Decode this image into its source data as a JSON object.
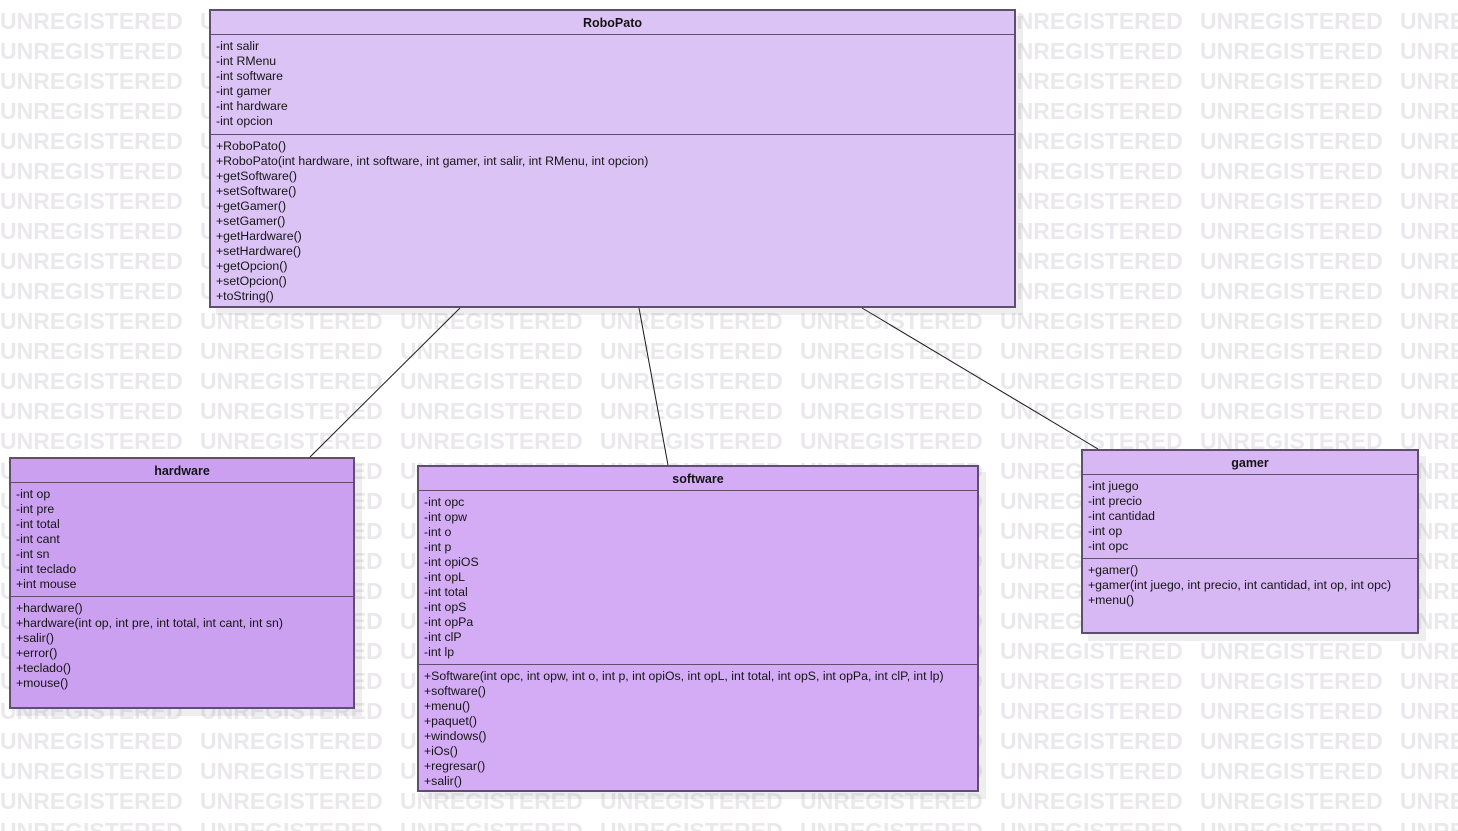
{
  "watermark": "UNREGISTERED",
  "colors": {
    "robopato_fill": "#dcc3f5",
    "hardware_fill": "#cba0f0",
    "software_fill": "#d3acf5",
    "gamer_fill": "#d8b7f5",
    "border": "#5e4f6e",
    "watermark_text": "#eae8ec"
  },
  "classes": {
    "robopato": {
      "name": "RoboPato",
      "attributes": [
        "-int salir",
        "-int RMenu",
        "-int software",
        "-int gamer",
        "-int hardware",
        "-int opcion"
      ],
      "methods": [
        "+RoboPato()",
        "+RoboPato(int hardware, int software, int gamer, int salir, int RMenu, int opcion)",
        "+getSoftware()",
        "+setSoftware()",
        "+getGamer()",
        "+setGamer()",
        "+getHardware()",
        "+setHardware()",
        "+getOpcion()",
        "+setOpcion()",
        "+toString()"
      ]
    },
    "hardware": {
      "name": "hardware",
      "attributes": [
        "-int op",
        "-int pre",
        "-int total",
        "-int cant",
        "-int sn",
        "-int teclado",
        "+int mouse"
      ],
      "methods": [
        "+hardware()",
        "+hardware(int op, int pre, int total, int cant, int sn)",
        "+salir()",
        "+error()",
        "+teclado()",
        "+mouse()"
      ]
    },
    "software": {
      "name": "software",
      "attributes": [
        "-int opc",
        "-int opw",
        "-int o",
        "-int p",
        "-int opiOS",
        "-int opL",
        "-int total",
        "-int opS",
        "-int opPa",
        "-int clP",
        "-int lp"
      ],
      "methods": [
        "+Software(int opc, int opw, int o, int p, int opiOs, int opL, int total, int opS, int opPa, int clP, int lp)",
        "+software()",
        "+menu()",
        "+paquet()",
        "+windows()",
        "+iOs()",
        "+regresar()",
        "+salir()"
      ]
    },
    "gamer": {
      "name": "gamer",
      "attributes": [
        "-int juego",
        "-int precio",
        "-int cantidad",
        "-int op",
        "-int opc"
      ],
      "methods": [
        "+gamer()",
        "+gamer(int juego, int precio, int cantidad, int op, int opc)",
        "+menu()"
      ]
    }
  },
  "associations": [
    {
      "from": "RoboPato",
      "to": "hardware"
    },
    {
      "from": "RoboPato",
      "to": "software"
    },
    {
      "from": "RoboPato",
      "to": "gamer"
    }
  ]
}
